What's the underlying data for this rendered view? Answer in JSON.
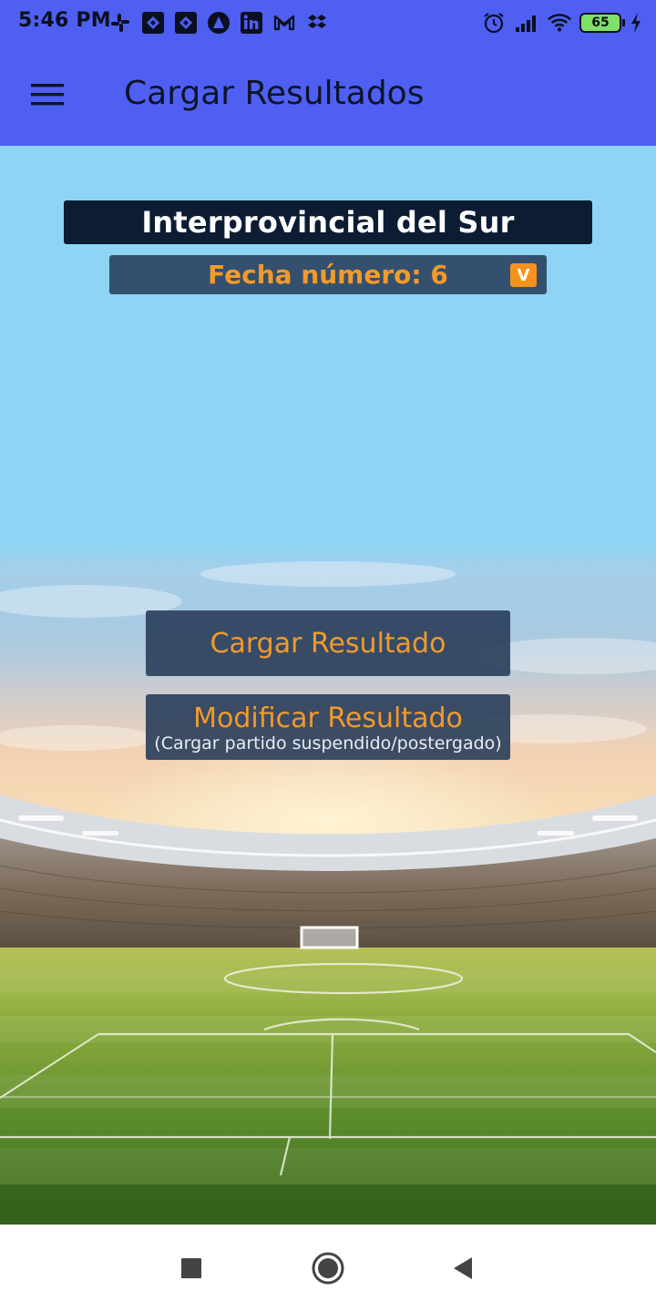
{
  "status_bar": {
    "time": "5:46 PM",
    "left_icons": [
      "slack-icon",
      "jira-icon",
      "jira-icon",
      "notification-app-icon",
      "linkedin-icon",
      "gmail-icon",
      "dropbox-icon"
    ],
    "right_icons": [
      "alarm-icon",
      "signal-icon",
      "wifi-icon",
      "battery-icon",
      "charging-icon"
    ],
    "battery_percent": "65"
  },
  "app_bar": {
    "menu_icon": "hamburger-menu-icon",
    "title": "Cargar Resultados"
  },
  "league": {
    "name": "Interprovincial del Sur"
  },
  "round_selector": {
    "label": "Fecha número: 6",
    "badge": "V"
  },
  "actions": {
    "load_result": "Cargar Resultado",
    "modify_result": "Modificar Resultado",
    "modify_result_note": "(Cargar partido suspendido/postergado)"
  },
  "nav_bar": {
    "icons": [
      "recent-apps-icon",
      "home-icon",
      "back-icon"
    ]
  },
  "colors": {
    "app_bar": "#4E5FF2",
    "sky": "#8FD4F4",
    "league_banner": "#0C1C33",
    "selector_bg": "#34506E",
    "accent_orange": "#F29A2A",
    "button_bg": "#2C405C"
  }
}
